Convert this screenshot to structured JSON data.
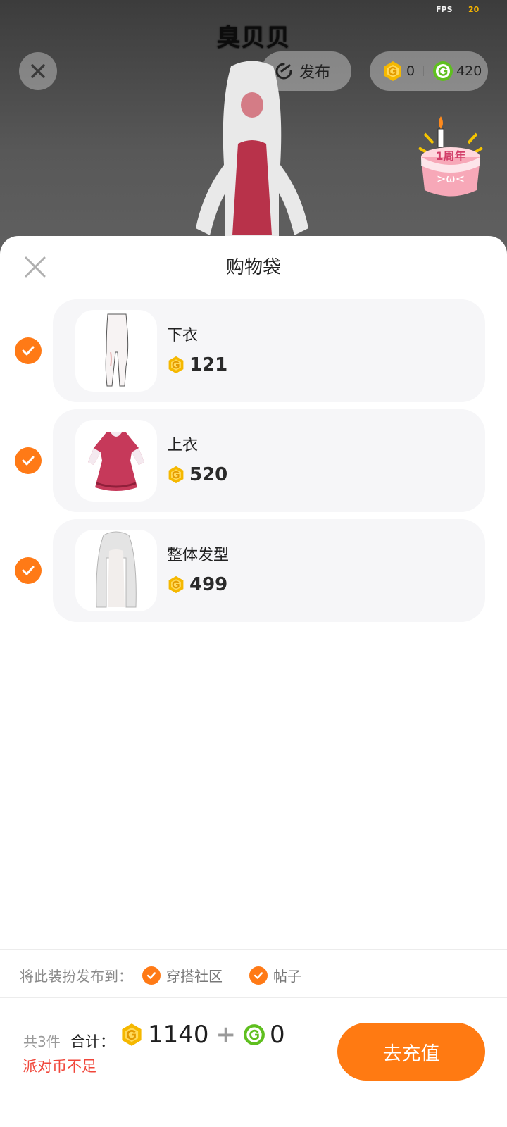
{
  "top_bar": {
    "fps_label": "FPS",
    "fps_value": "20",
    "player_name": "臭贝贝",
    "publish_label": "发布",
    "coin_gold_value": "0",
    "coin_green_value": "420"
  },
  "sheet": {
    "title": "购物袋",
    "items": [
      {
        "name": "下衣",
        "price": "121",
        "checked": true,
        "thumb_icon": "leggings-icon"
      },
      {
        "name": "上衣",
        "price": "520",
        "checked": true,
        "thumb_icon": "dress-icon"
      },
      {
        "name": "整体发型",
        "price": "499",
        "checked": true,
        "thumb_icon": "hairstyle-icon"
      }
    ],
    "publish_to": {
      "label": "将此装扮发布到：",
      "options": [
        {
          "label": "穿搭社区",
          "checked": true
        },
        {
          "label": "帖子",
          "checked": true
        }
      ]
    },
    "footer": {
      "count_text": "共3件",
      "total_label": "合计：",
      "total_gold": "1140",
      "plus": "+",
      "total_green": "0",
      "warning": "派对币不足",
      "recharge_label": "去充值"
    }
  },
  "colors": {
    "accent_orange": "#ff7a16",
    "warning_red": "#f0463a",
    "gold_coin": "#f5b800",
    "green_coin": "#5fbf1f"
  }
}
